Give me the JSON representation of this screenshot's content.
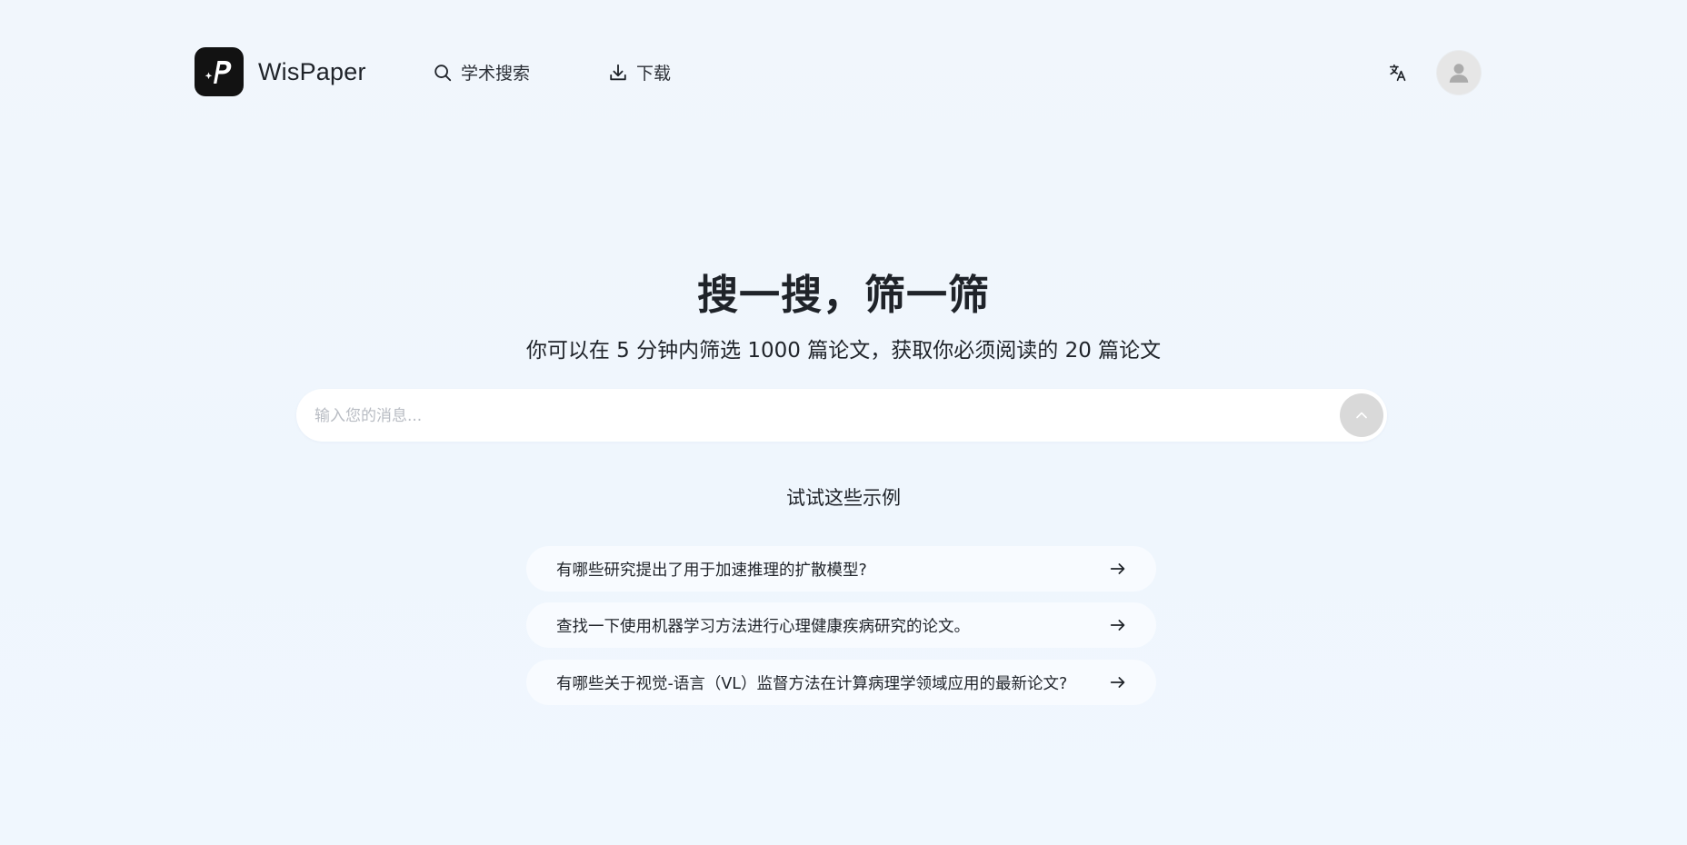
{
  "brand": {
    "name": "WisPaper",
    "logo_icon": "wispaper-p-logo-icon"
  },
  "nav": {
    "items": [
      {
        "label": "学术搜索",
        "icon": "search-icon"
      },
      {
        "label": "下载",
        "icon": "download-icon"
      }
    ]
  },
  "header_actions": {
    "language_icon": "translate-icon",
    "avatar_icon": "user-icon"
  },
  "hero": {
    "title": "搜一搜，筛一筛",
    "subtitle": "你可以在 5 分钟内筛选 1000 篇论文，获取你必须阅读的 20 篇论文"
  },
  "search": {
    "placeholder": "输入您的消息...",
    "value": "",
    "send_icon": "chevron-up-icon"
  },
  "examples": {
    "title": "试试这些示例",
    "items": [
      {
        "label": "有哪些研究提出了用于加速推理的扩散模型?"
      },
      {
        "label": "查找一下使用机器学习方法进行心理健康疾病研究的论文。"
      },
      {
        "label": "有哪些关于视觉-语言（VL）监督方法在计算病理学领域应用的最新论文?"
      }
    ],
    "arrow_icon": "arrow-right-icon"
  },
  "colors": {
    "background": "#f0f6fd",
    "logo_bg": "#121212",
    "send_button": "#d9d9d9",
    "avatar_bg": "#e6e6e6"
  }
}
